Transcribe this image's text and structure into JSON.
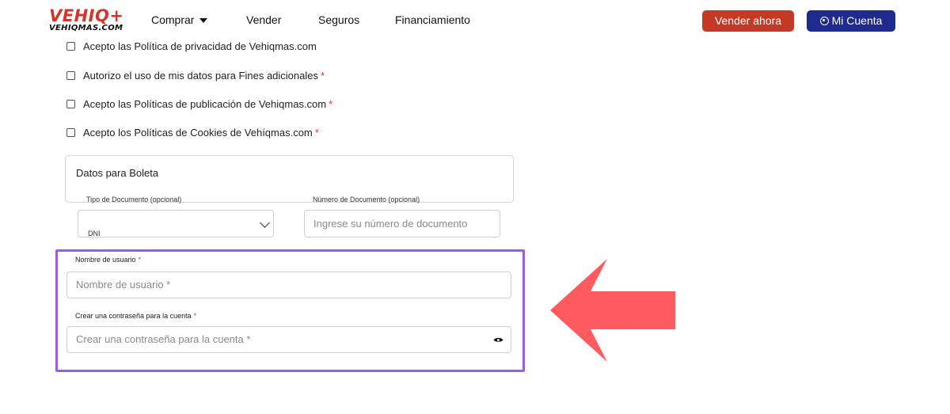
{
  "header": {
    "logo_main": "VEHIQ+",
    "logo_sub": "VEHIQMAS.COM",
    "nav": {
      "comprar": "Comprar",
      "vender": "Vender",
      "seguros": "Seguros",
      "financiamiento": "Financiamiento"
    },
    "sell_now_label": "Vender ahora",
    "account_label": "Mi Cuenta"
  },
  "consents": [
    {
      "label": "Acepto las Política de privacidad de Vehiqmas.com",
      "required": false
    },
    {
      "label": "Autorizo el uso de mis datos para Fines adicionales",
      "required": true
    },
    {
      "label": "Acepto las Políticas de publicación de Vehiqmas.com",
      "required": true
    },
    {
      "label": "Acepto los Políticas de Cookies de Vehíqmas.com",
      "required": true
    }
  ],
  "required_mark": "*",
  "boleta": {
    "title": "Datos para Boleta",
    "doc_type_label": "Tipo de Documento (opcional)",
    "doc_type_value": "DNI",
    "doc_number_label": "Número de Documento (opcional)",
    "doc_number_placeholder": "Ingrese su número de documento"
  },
  "account": {
    "username_label": "Nombre de usuario",
    "username_placeholder": "Nombre de usuario *",
    "password_label": "Crear una contraseña para la cuenta",
    "password_placeholder": "Crear una contraseña para la cuenta *"
  },
  "colors": {
    "brand_red": "#d8322a",
    "sell_button": "#c53a24",
    "account_button": "#1e2a8c",
    "highlight_border": "#9b5de5",
    "arrow": "#ff5a5f",
    "required": "#e0312b"
  },
  "icons": {
    "nav_dropdown": "caret-down-icon",
    "account": "user-circle-icon",
    "select": "chevron-down-icon",
    "password_toggle": "eye-icon",
    "callout": "arrow-left-icon"
  }
}
